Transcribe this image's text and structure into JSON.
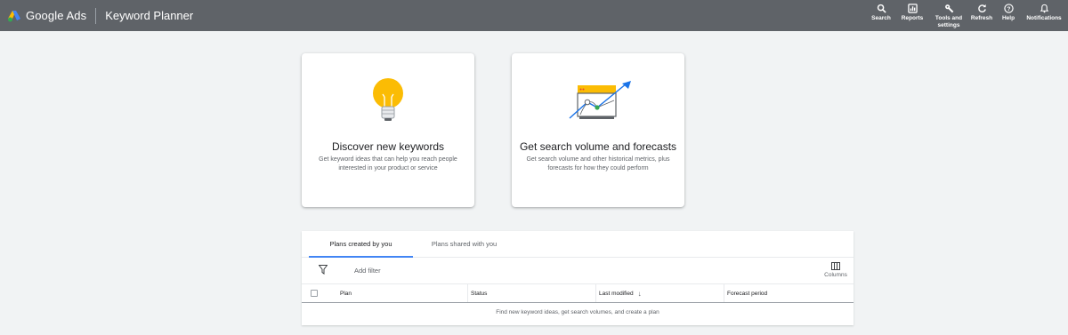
{
  "header": {
    "brand": "Google Ads",
    "page_title": "Keyword Planner",
    "background_color": "#5f6368",
    "logo_icon": "google-ads-logo",
    "tools": [
      {
        "label": "Search",
        "icon": "search-icon"
      },
      {
        "label": "Reports",
        "icon": "reports-icon"
      },
      {
        "label": "Tools and settings",
        "icon": "wrench-icon"
      },
      {
        "label": "Refresh",
        "icon": "refresh-icon"
      },
      {
        "label": "Help",
        "icon": "help-icon"
      },
      {
        "label": "Notifications",
        "icon": "bell-icon"
      }
    ]
  },
  "cards": {
    "discover": {
      "title": "Discover new keywords",
      "description": "Get keyword ideas that can help you reach people interested in your product or service",
      "icon": "lightbulb-icon",
      "icon_color": "#fbbc04"
    },
    "forecast": {
      "title": "Get search volume and forecasts",
      "description": "Get search volume and other historical metrics, plus forecasts for how they could perform",
      "icon": "trend-chart-icon"
    }
  },
  "plans": {
    "tabs": [
      "Plans created by you",
      "Plans shared with you"
    ],
    "active_tab": "Plans created by you",
    "accent_color": "#4285f4",
    "add_filter": "Add filter",
    "columns_label": "Columns",
    "columns": [
      "Plan",
      "Status",
      "Last modified",
      "Forecast period"
    ],
    "sort_indicator": "↓",
    "empty_message": "Find new keyword ideas, get search volumes, and create a plan"
  }
}
